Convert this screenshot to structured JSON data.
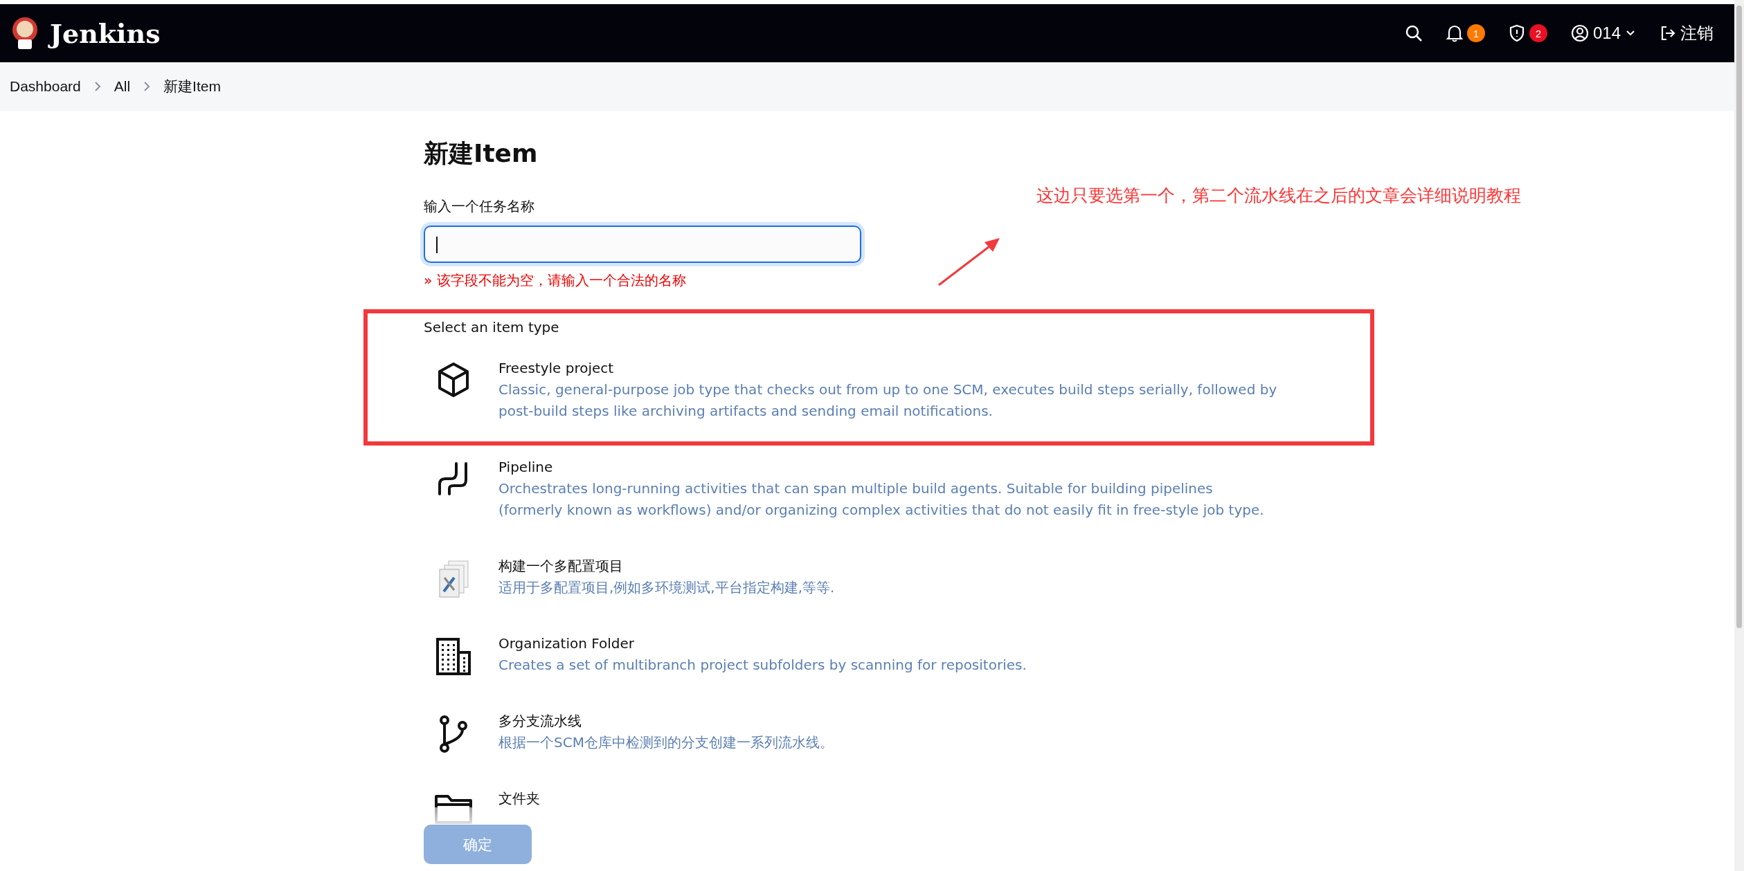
{
  "header": {
    "brand": "Jenkins",
    "notifications": "1",
    "security": "2",
    "user": "014",
    "logout": "注销"
  },
  "breadcrumbs": [
    "Dashboard",
    "All",
    "新建Item"
  ],
  "title": "新建Item",
  "name_field": {
    "label": "输入一个任务名称",
    "focused": true,
    "error": "» 该字段不能为空，请输入一个合法的名称"
  },
  "section_label": "Select an item type",
  "item_types": [
    {
      "kind": "freestyle",
      "title": "Freestyle project",
      "description": "Classic, general-purpose job type that checks out from up to one SCM, executes build steps serially, followed by post-build steps like archiving artifacts and sending email notifications.",
      "highlighted": true
    },
    {
      "kind": "pipeline",
      "title": "Pipeline",
      "description": "Orchestrates long-running activities that can span multiple build agents. Suitable for building pipelines (formerly known as workflows) and/or organizing complex activities that do not easily fit in free-style job type.",
      "highlighted": false
    },
    {
      "kind": "matrix",
      "title": "构建一个多配置项目",
      "description": "适用于多配置项目,例如多环境测试,平台指定构建,等等.",
      "highlighted": false
    },
    {
      "kind": "organization",
      "title": "Organization Folder",
      "description": "Creates a set of multibranch project subfolders by scanning for repositories.",
      "highlighted": false
    },
    {
      "kind": "multibranch",
      "title": "多分支流水线",
      "description": "根据一个SCM仓库中检测到的分支创建一系列流水线。",
      "highlighted": false
    },
    {
      "kind": "folder",
      "title": "文件夹",
      "highlighted": false
    }
  ],
  "annotation": {
    "text": "这边只要选第一个，第二个流水线在之后的文章会详细说明教程"
  },
  "ok_button": {
    "label": "确定",
    "disabled": true
  }
}
